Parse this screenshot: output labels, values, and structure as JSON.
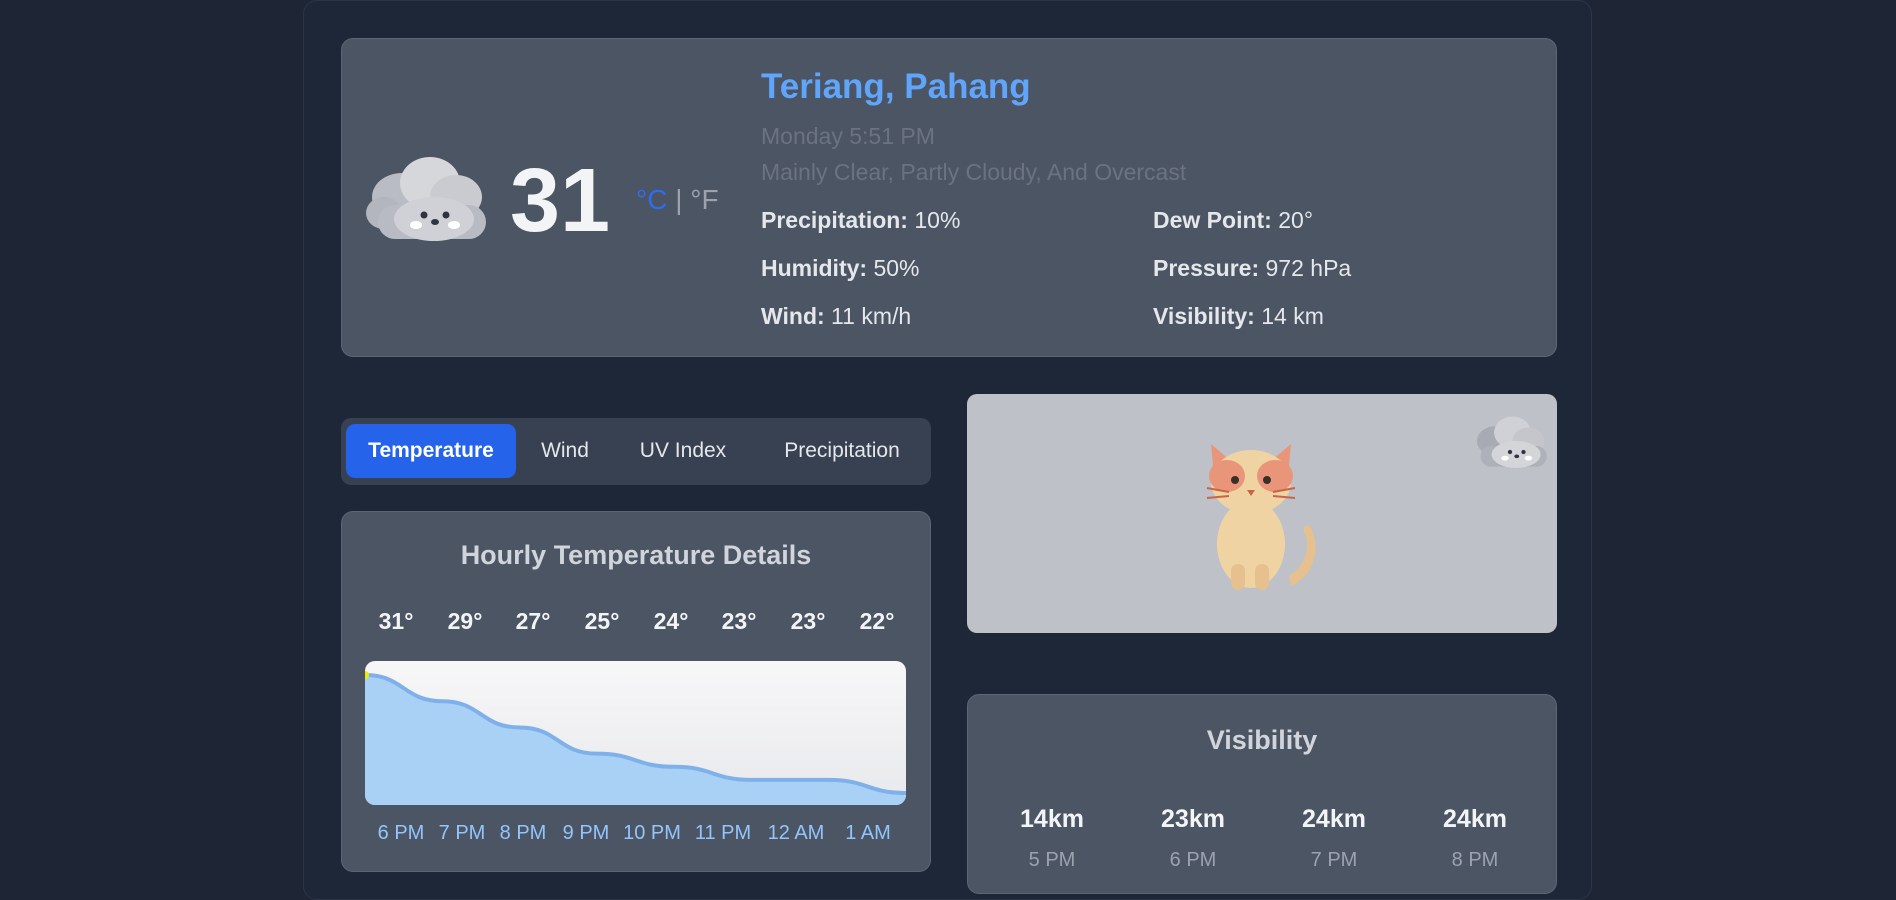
{
  "current": {
    "location": "Teriang, Pahang",
    "datetime": "Monday 5:51 PM",
    "condition": "Mainly Clear, Partly Cloudy, And Overcast",
    "temperature": "31",
    "unit_c": "°C",
    "unit_sep": "|",
    "unit_f": "°F",
    "icon": "cloud-face-icon",
    "stats": [
      {
        "label": "Precipitation:",
        "value": "10%"
      },
      {
        "label": "Dew Point:",
        "value": "20°"
      },
      {
        "label": "Humidity:",
        "value": "50%"
      },
      {
        "label": "Pressure:",
        "value": "972 hPa"
      },
      {
        "label": "Wind:",
        "value": "11 km/h"
      },
      {
        "label": "Visibility:",
        "value": "14 km"
      }
    ]
  },
  "tabs": [
    {
      "label": "Temperature",
      "active": true
    },
    {
      "label": "Wind",
      "active": false
    },
    {
      "label": "UV Index",
      "active": false
    },
    {
      "label": "Precipitation",
      "active": false
    }
  ],
  "hourly": {
    "title": "Hourly Temperature Details",
    "temps": [
      "31°",
      "29°",
      "27°",
      "25°",
      "24°",
      "23°",
      "23°",
      "22°"
    ],
    "times": [
      "6 PM",
      "7 PM",
      "8 PM",
      "9 PM",
      "10 PM",
      "11 PM",
      "12 AM",
      "1 AM"
    ]
  },
  "chart_data": {
    "type": "area",
    "title": "",
    "x": [
      "6 PM",
      "7 PM",
      "8 PM",
      "9 PM",
      "10 PM",
      "11 PM",
      "12 AM",
      "1 AM"
    ],
    "values": [
      31,
      29,
      27,
      25,
      24,
      23,
      23,
      22
    ],
    "xlabel": "",
    "ylabel": "",
    "grid": false,
    "colors": {
      "fill": "#a9d1f5",
      "line": "#7fb0ea",
      "highlight": "#e8f000"
    }
  },
  "illustration": {
    "cat": "cat-icon",
    "cloud": "cloud-face-icon"
  },
  "visibility": {
    "title": "Visibility",
    "items": [
      {
        "value": "14km",
        "time": "5 PM"
      },
      {
        "value": "23km",
        "time": "6 PM"
      },
      {
        "value": "24km",
        "time": "7 PM"
      },
      {
        "value": "24km",
        "time": "8 PM"
      }
    ]
  },
  "colors": {
    "accent": "#2563eb",
    "city": "#60a5fa",
    "panel": "#4b5563",
    "background": "#1e2636"
  }
}
